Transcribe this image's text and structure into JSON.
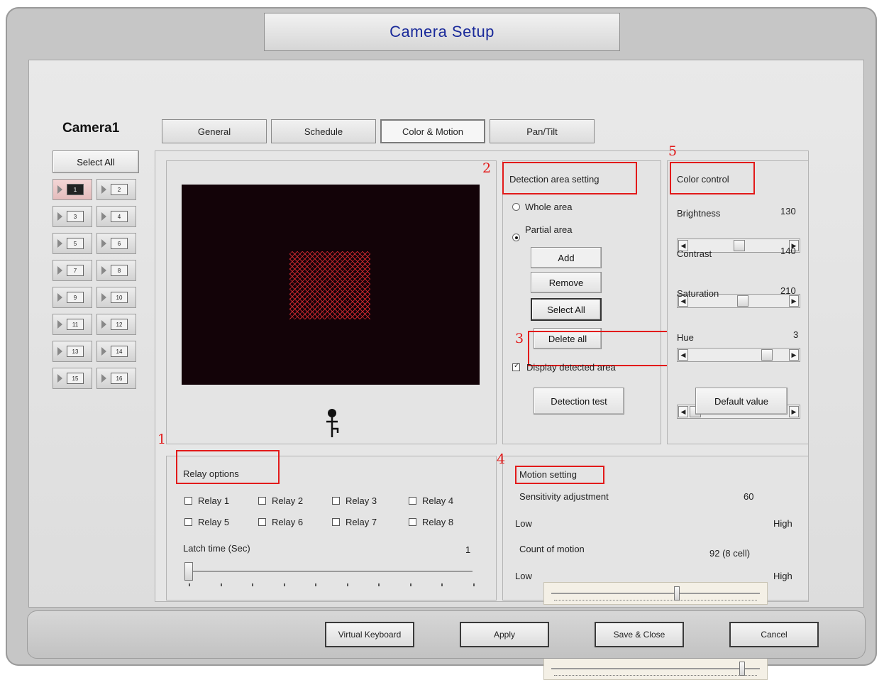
{
  "window": {
    "title": "Camera Setup"
  },
  "camera": {
    "name": "Camera1",
    "select_all": "Select All",
    "channels": [
      "1",
      "2",
      "3",
      "4",
      "5",
      "6",
      "7",
      "8",
      "9",
      "10",
      "11",
      "12",
      "13",
      "14",
      "15",
      "16"
    ],
    "selected_channel": "1"
  },
  "tabs": [
    {
      "label": "General"
    },
    {
      "label": "Schedule"
    },
    {
      "label": "Color & Motion"
    },
    {
      "label": "Pan/Tilt"
    }
  ],
  "active_tab": "Color & Motion",
  "annotations": {
    "n1": "1",
    "n2": "2",
    "n3": "3",
    "n4": "4",
    "n5": "5"
  },
  "detection": {
    "heading": "Detection area setting",
    "whole_area": "Whole area",
    "partial_area": "Partial area",
    "selected_mode": "Partial area",
    "add": "Add",
    "remove": "Remove",
    "select_all": "Select All",
    "delete_all": "Delete all",
    "display_detected": "Display detected area",
    "display_detected_checked": true,
    "detection_test": "Detection test"
  },
  "color_control": {
    "heading": "Color control",
    "brightness": {
      "label": "Brightness",
      "value": "130",
      "level": 0.51
    },
    "contrast": {
      "label": "Contrast",
      "value": "140",
      "level": 0.55
    },
    "saturation": {
      "label": "Saturation",
      "value": "210",
      "level": 0.82
    },
    "hue": {
      "label": "Hue",
      "value": "3",
      "level": 0.01
    },
    "default_value": "Default value"
  },
  "relay": {
    "heading": "Relay options",
    "relays": [
      "Relay 1",
      "Relay 2",
      "Relay 3",
      "Relay 4",
      "Relay 5",
      "Relay 6",
      "Relay 7",
      "Relay 8"
    ],
    "latch_label": "Latch time (Sec)",
    "latch_value": "1",
    "latch_level": 0.0
  },
  "motion": {
    "heading": "Motion setting",
    "sensitivity_label": "Sensitivity adjustment",
    "sensitivity_value": "60",
    "sensitivity_level": 0.6,
    "count_label": "Count of motion",
    "count_value": "92 (8 cell)",
    "count_level": 0.92,
    "low": "Low",
    "high": "High"
  },
  "footer": {
    "virtual_keyboard": "Virtual Keyboard",
    "apply": "Apply",
    "save_close": "Save & Close",
    "cancel": "Cancel"
  },
  "colors": {
    "accent": "#1a2a9a",
    "annotation": "#e21a1a",
    "video_bg": "#130308",
    "motion_grid": "#c0242c"
  }
}
